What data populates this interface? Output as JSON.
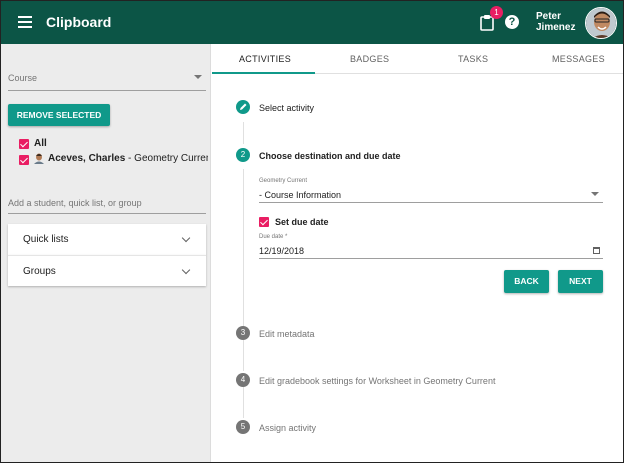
{
  "header": {
    "title": "Clipboard",
    "notification_count": "1",
    "help_glyph": "?",
    "user_first": "Peter",
    "user_last": "Jimenez",
    "color": "#0c5546"
  },
  "sidebar": {
    "course_label": "Course",
    "remove_button": "REMOVE SELECTED",
    "all_label": "All",
    "student_name": "Aceves, Charles",
    "student_course": " - Geometry Current",
    "add_placeholder": "Add a student, quick list, or group",
    "panels": [
      {
        "label": "Quick lists",
        "icon": "chevron-down-icon"
      },
      {
        "label": "Groups",
        "icon": "chevron-down-icon"
      }
    ]
  },
  "tabs": [
    "ACTIVITIES",
    "BADGES",
    "TASKS",
    "MESSAGES"
  ],
  "active_tab": "ACTIVITIES",
  "stepper": {
    "step1": {
      "label": "Select activity",
      "icon": "pencil-icon"
    },
    "step2": {
      "number": "2",
      "label": "Choose destination and due date",
      "destination_caption": "Geometry Current",
      "destination_value": "- Course Information",
      "due_checkbox_label": "Set due date",
      "due_caption": "Due date *",
      "due_value": "12/19/2018",
      "back_button": "BACK",
      "next_button": "NEXT"
    },
    "step3": {
      "number": "3",
      "label": "Edit metadata"
    },
    "step4": {
      "number": "4",
      "label": "Edit gradebook settings for Worksheet in Geometry Current"
    },
    "step5": {
      "number": "5",
      "label": "Assign activity"
    }
  },
  "colors": {
    "accent": "#10998a",
    "checkbox": "#e91e63",
    "badge": "#e91e63"
  }
}
